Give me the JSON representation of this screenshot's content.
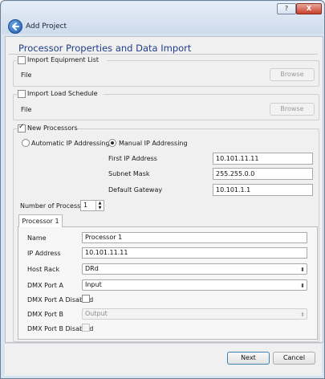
{
  "window": {
    "help_label": "?",
    "close_label": "X",
    "title": "Add Project"
  },
  "page": {
    "heading": "Processor Properties and Data Import"
  },
  "import_equipment": {
    "checkbox_label": "Import Equipment List",
    "file_label": "File",
    "browse_label": "Browse"
  },
  "import_load": {
    "checkbox_label": "Import Load Schedule",
    "file_label": "File",
    "browse_label": "Browse"
  },
  "new_processors": {
    "checkbox_label": "New Processors",
    "automatic_label": "Automatic IP Addressing",
    "manual_label": "Manual IP Addressing",
    "selected_mode": "manual",
    "first_ip_label": "First IP Address",
    "first_ip_value": "10.101.11.11",
    "subnet_label": "Subnet Mask",
    "subnet_value": "255.255.0.0",
    "gateway_label": "Default Gateway",
    "gateway_value": "10.101.1.1",
    "count_label": "Number of Processors",
    "count_value": "1"
  },
  "tab": {
    "label": "Processor 1",
    "name_label": "Name",
    "name_value": "Processor 1",
    "ip_label": "IP Address",
    "ip_value": "10.101.11.11",
    "host_rack_label": "Host Rack",
    "host_rack_value": "DRd",
    "dmx_a_label": "DMX Port A",
    "dmx_a_value": "Input",
    "dmx_a_disabled_label": "DMX Port A Disabled",
    "dmx_b_label": "DMX Port B",
    "dmx_b_value": "Output",
    "dmx_b_disabled_label": "DMX Port B Disabled"
  },
  "footer": {
    "next_label": "Next",
    "cancel_label": "Cancel"
  },
  "colors": {
    "heading": "#1f3f86",
    "title_bar": "#cddbeb",
    "close_button": "#c7412c"
  },
  "icons": [
    "back-arrow-icon",
    "close-icon",
    "help-icon",
    "checkmark-icon",
    "spin-up-icon",
    "spin-down-icon",
    "dropdown-arrow-icon"
  ]
}
